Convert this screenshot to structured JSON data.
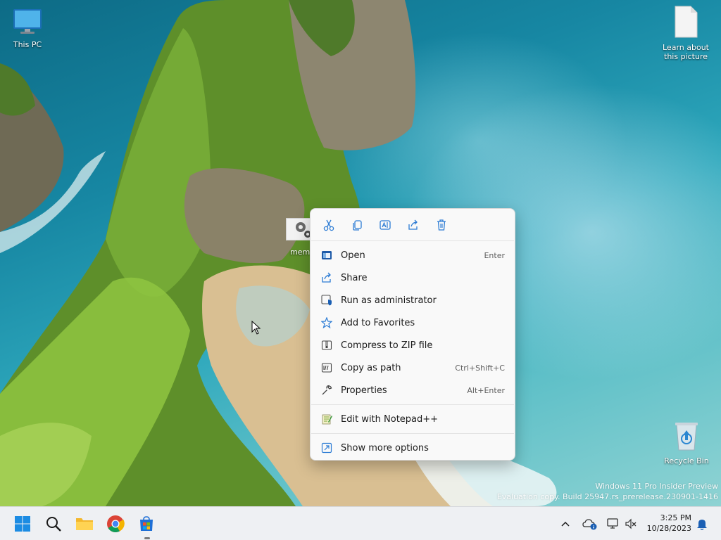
{
  "desktop": {
    "icons": [
      {
        "label": "This PC",
        "icon": "monitor-icon"
      },
      {
        "label": "Learn about this picture",
        "icon": "document-icon"
      },
      {
        "label": "Recycle Bin",
        "icon": "recycle-bin-icon"
      },
      {
        "label": "mem",
        "icon": "settings-gear-icon"
      }
    ],
    "watermark": {
      "line1": "Windows 11 Pro Insider Preview",
      "line2": "Evaluation copy. Build 25947.rs_prerelease.230901-1416"
    }
  },
  "context_menu": {
    "toolbar": [
      {
        "name": "cut",
        "icon": "scissors-icon"
      },
      {
        "name": "copy",
        "icon": "copy-icon"
      },
      {
        "name": "rename",
        "icon": "rename-icon"
      },
      {
        "name": "share",
        "icon": "share-icon"
      },
      {
        "name": "delete",
        "icon": "trash-icon"
      }
    ],
    "items": [
      {
        "label": "Open",
        "shortcut": "Enter",
        "icon": "open-window-icon"
      },
      {
        "label": "Share",
        "shortcut": "",
        "icon": "share-icon"
      },
      {
        "label": "Run as administrator",
        "shortcut": "",
        "icon": "shield-icon"
      },
      {
        "label": "Add to Favorites",
        "shortcut": "",
        "icon": "star-icon"
      },
      {
        "label": "Compress to ZIP file",
        "shortcut": "",
        "icon": "zip-folder-icon"
      },
      {
        "label": "Copy as path",
        "shortcut": "Ctrl+Shift+C",
        "icon": "path-icon"
      },
      {
        "label": "Properties",
        "shortcut": "Alt+Enter",
        "icon": "wrench-icon"
      },
      {
        "label": "Edit with Notepad++",
        "shortcut": "",
        "icon": "notepad-plus-icon"
      },
      {
        "label": "Show more options",
        "shortcut": "",
        "icon": "expand-icon"
      }
    ]
  },
  "taskbar": {
    "apps": [
      {
        "name": "Start",
        "icon": "windows-start-icon"
      },
      {
        "name": "Search",
        "icon": "search-icon"
      },
      {
        "name": "File Explorer",
        "icon": "folder-icon"
      },
      {
        "name": "Google Chrome",
        "icon": "chrome-icon"
      },
      {
        "name": "Microsoft Store",
        "icon": "store-icon"
      }
    ],
    "tray": {
      "time": "3:25 PM",
      "date": "10/28/2023"
    }
  },
  "colors": {
    "accent": "#0067c0",
    "menu_bg": "#f9f9f9",
    "taskbar_bg": "#eef0f3"
  }
}
